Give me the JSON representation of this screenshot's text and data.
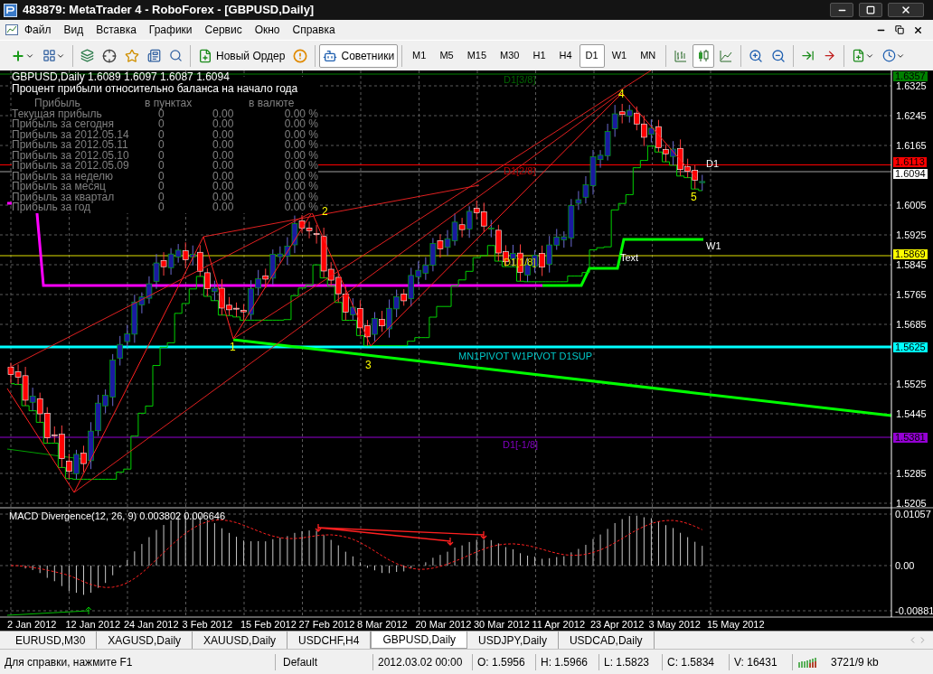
{
  "window": {
    "title": "483879: MetaTrader 4 - RoboForex - [GBPUSD,Daily]"
  },
  "menu": [
    "Файл",
    "Вид",
    "Вставка",
    "Графики",
    "Сервис",
    "Окно",
    "Справка"
  ],
  "toolbar": {
    "new_order": "Новый Ордер",
    "experts": {
      "label": "Советники",
      "on": true
    },
    "timeframes": [
      {
        "label": "M1",
        "selected": false
      },
      {
        "label": "M5",
        "selected": false
      },
      {
        "label": "M15",
        "selected": false
      },
      {
        "label": "M30",
        "selected": false
      },
      {
        "label": "H1",
        "selected": false
      },
      {
        "label": "H4",
        "selected": false
      },
      {
        "label": "D1",
        "selected": true
      },
      {
        "label": "W1",
        "selected": false
      },
      {
        "label": "MN",
        "selected": false
      }
    ],
    "chart_types": [
      {
        "kind": "bars",
        "selected": false
      },
      {
        "kind": "candles",
        "selected": true
      },
      {
        "kind": "line",
        "selected": false
      }
    ]
  },
  "chart": {
    "header": "GBPUSD,Daily  1.6089 1.6097 1.6087 1.6094",
    "subtitle": "Процент прибыли относительно баланса на начало года",
    "profit_table": {
      "columns": [
        "Прибыль",
        "в пунктах",
        "в валюте"
      ],
      "rows": [
        {
          "label": "Текущая прибыль",
          "points": "0",
          "amount": "0.00",
          "percent": "0.00 %"
        },
        {
          "label": "Прибыль за сегодня",
          "points": "0",
          "amount": "0.00",
          "percent": "0.00 %"
        },
        {
          "label": "Прибыль за 2012.05.14",
          "points": "0",
          "amount": "0.00",
          "percent": "0.00 %"
        },
        {
          "label": "Прибыль за 2012.05.11",
          "points": "0",
          "amount": "0.00",
          "percent": "0.00 %"
        },
        {
          "label": "Прибыль за 2012.05.10",
          "points": "0",
          "amount": "0.00",
          "percent": "0.00 %"
        },
        {
          "label": "Прибыль за 2012.05.09",
          "points": "0",
          "amount": "0.00",
          "percent": "0.00 %"
        },
        {
          "label": "Прибыль за неделю",
          "points": "0",
          "amount": "0.00",
          "percent": "0.00 %"
        },
        {
          "label": "Прибыль за месяц",
          "points": "0",
          "amount": "0.00",
          "percent": "0.00 %"
        },
        {
          "label": "Прибыль за квартал",
          "points": "0",
          "amount": "0.00",
          "percent": "0.00 %"
        },
        {
          "label": "Прибыль за год",
          "points": "0",
          "amount": "0.00",
          "percent": "0.00 %"
        }
      ]
    },
    "labels": [
      {
        "text": "D1[3/8]",
        "color": "#006400"
      },
      {
        "text": "D1",
        "color": "#ffffff"
      },
      {
        "text": "D1[2/8]",
        "color": "#c00000"
      },
      {
        "text": "W1",
        "color": "#ffffff"
      },
      {
        "text": "Text",
        "color": "#ffffff"
      },
      {
        "text": "D1[1/8]",
        "color": "#e0e000"
      },
      {
        "text": "MN1PIVOT W1PIVOT D1SUP",
        "color": "#00c8c8"
      },
      {
        "text": "D1[-1/8]",
        "color": "#8000c0"
      }
    ],
    "wave_labels": [
      "1",
      "2",
      "3",
      "4",
      "5"
    ],
    "price_ticks": [
      "1.6325",
      "1.6245",
      "1.6165",
      "1.6005",
      "1.5925",
      "1.5845",
      "1.5765",
      "1.5685",
      "1.5525",
      "1.5445",
      "1.5285",
      "1.5205"
    ],
    "price_tags": [
      {
        "text": "1.6357",
        "color": "#008000"
      },
      {
        "text": "1.6113",
        "color": "#ff0000"
      },
      {
        "text": "1.6094",
        "color": "#ffffff"
      },
      {
        "text": "1.5869",
        "color": "#ffff00"
      },
      {
        "text": "1.5625",
        "color": "#00ffff"
      },
      {
        "text": "1.5381",
        "color": "#9400d3"
      }
    ]
  },
  "macd": {
    "label": "MACD Divergence(12, 26, 9) 0.003802 0.006646",
    "axis": [
      "0.01057",
      "0.00",
      "-0.00881"
    ]
  },
  "time_axis": [
    "2 Jan 2012",
    "12 Jan 2012",
    "24 Jan 2012",
    "3 Feb 2012",
    "15 Feb 2012",
    "27 Feb 2012",
    "8 Mar 2012",
    "20 Mar 2012",
    "30 Mar 2012",
    "11 Apr 2012",
    "23 Apr 2012",
    "3 May 2012",
    "15 May 2012"
  ],
  "tabs": [
    {
      "label": "EURUSD,M30",
      "selected": false
    },
    {
      "label": "XAGUSD,Daily",
      "selected": false
    },
    {
      "label": "XAUUSD,Daily",
      "selected": false
    },
    {
      "label": "USDCHF,H4",
      "selected": false
    },
    {
      "label": "GBPUSD,Daily",
      "selected": true
    },
    {
      "label": "USDJPY,Daily",
      "selected": false
    },
    {
      "label": "USDCAD,Daily",
      "selected": false
    }
  ],
  "status_bar": {
    "help": "Для справки, нажмите F1",
    "profile": "Default",
    "time": "2012.03.02 00:00",
    "open": "O: 1.5956",
    "high": "H: 1.5966",
    "low": "L: 1.5823",
    "close": "C: 1.5834",
    "volume": "V: 16431",
    "traffic": "3721/9 kb"
  }
}
